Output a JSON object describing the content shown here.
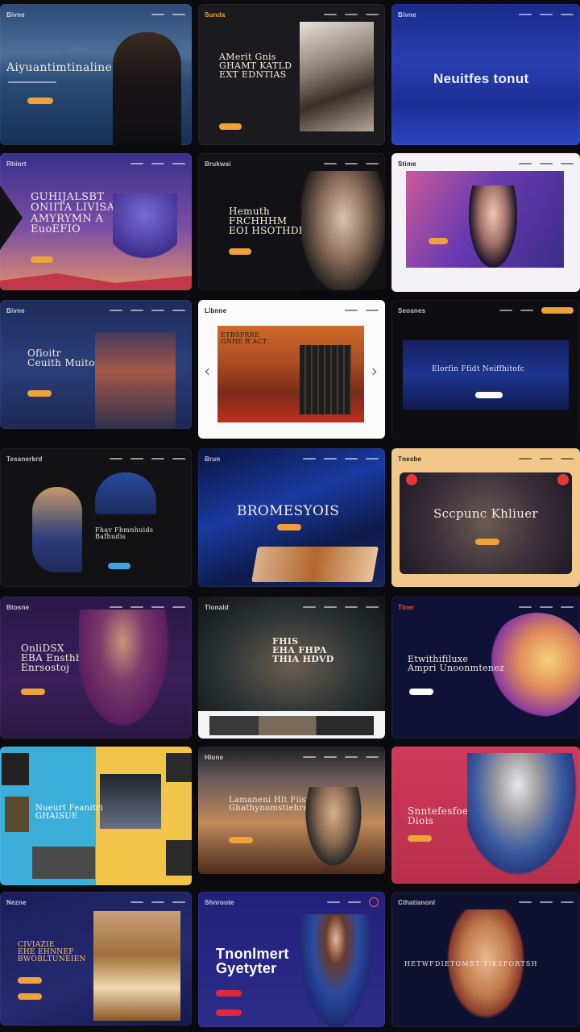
{
  "tiles": {
    "t1": {
      "logo": "Bivne",
      "headline": "Aiyuantimtinaline"
    },
    "t2": {
      "logo": "Sunda",
      "headline": "AMerit Gnis\nGHAMT KATLD\nEXT EDNTIAS"
    },
    "t3": {
      "logo": "Bivne",
      "headline": "Neuitfes tonut"
    },
    "t4": {
      "logo": "Rhinrt",
      "headline": "GUHIJALSBT\nONIITA LIVISAS\nAMYRYMN A\nEuoEFIO"
    },
    "t5": {
      "logo": "Brukwai",
      "headline": "Hemuth\nFRCHHHM\nEOI HSOTHDEY"
    },
    "t6": {
      "logo": "Stime",
      "headline": ""
    },
    "t7": {
      "logo": "Bivne",
      "headline": "Ofioitr\nCeuith Muito"
    },
    "t8": {
      "logo": "Libnne",
      "headline": "ETBSPRRE\nGNHE R'ACT"
    },
    "t9": {
      "logo": "Seoanes",
      "headline": "Elorfin Ffidt Neiffhitofc"
    },
    "t10": {
      "logo": "Tesanerkrd",
      "headline": "Fhav Fhmnhuids\nBafhudis"
    },
    "t11": {
      "logo": "Brun",
      "headline": "BROMESYOIS"
    },
    "t12": {
      "logo": "Tnesbe",
      "headline": "Sccpunc Khliuer"
    },
    "t13": {
      "logo": "Btosne",
      "headline": "OnliDSX\nEBA Ensthbqcl\nEnrsostoj"
    },
    "t14": {
      "logo": "Tlonald",
      "headline": "FHIS\nEHA FHPA\nTHIA HDVD"
    },
    "t15": {
      "logo": "Tiner",
      "headline": "Etwithifiluxe\nAmpri Unoonmtenez"
    },
    "t16": {
      "headline": "Nueurt Feanitri\nGHAISUE"
    },
    "t17": {
      "logo": "Hlone",
      "headline": "Lamaneni Hlt Fiistas\nGhathynomstiehre"
    },
    "t18": {
      "headline": "Snntefesfoetur\nDiois"
    },
    "t19": {
      "logo": "Nezne",
      "headline": "CIVIAZIE\nEHE EHNNEF\nBWOBLTUNEIEN"
    },
    "t20": {
      "logo": "Shnroote",
      "headline": "Tnonlmert\nGyetyter"
    },
    "t21": {
      "logo": "Cthatianonl",
      "headline": "HETWFDIETOMRT  TIKSFORTSH"
    }
  }
}
